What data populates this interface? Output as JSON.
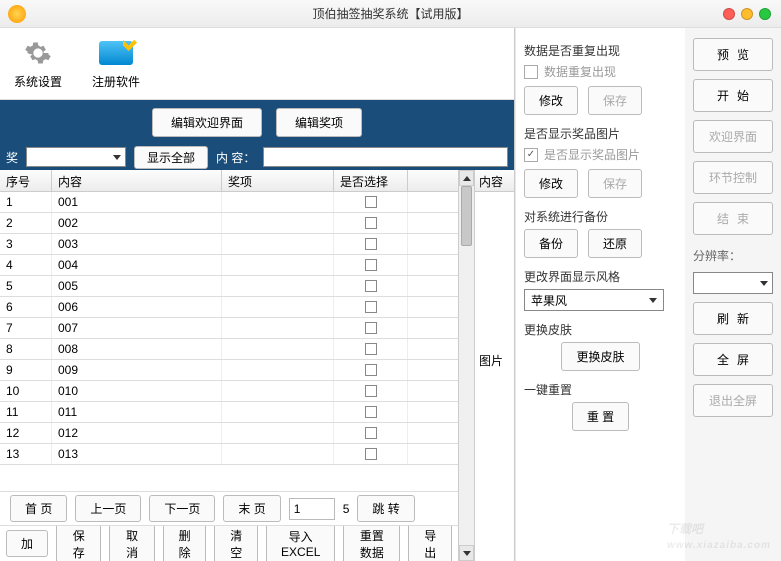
{
  "window": {
    "title": "顶伯抽签抽奖系统【试用版】"
  },
  "toolbar": {
    "settings": "系统设置",
    "register": "注册软件"
  },
  "bluebar": {
    "edit_welcome": "编辑欢迎界面",
    "edit_prize": "编辑奖项"
  },
  "filter": {
    "prize_label": "奖",
    "show_all": "显示全部",
    "content_label": "内    容："
  },
  "table": {
    "headers": {
      "seq": "序号",
      "content": "内容",
      "prize": "奖项",
      "selected": "是否选择"
    },
    "rows": [
      {
        "seq": "1",
        "content": "001"
      },
      {
        "seq": "2",
        "content": "002"
      },
      {
        "seq": "3",
        "content": "003"
      },
      {
        "seq": "4",
        "content": "004"
      },
      {
        "seq": "5",
        "content": "005"
      },
      {
        "seq": "6",
        "content": "006"
      },
      {
        "seq": "7",
        "content": "007"
      },
      {
        "seq": "8",
        "content": "008"
      },
      {
        "seq": "9",
        "content": "009"
      },
      {
        "seq": "10",
        "content": "010"
      },
      {
        "seq": "11",
        "content": "011"
      },
      {
        "seq": "12",
        "content": "012"
      },
      {
        "seq": "13",
        "content": "013"
      }
    ]
  },
  "side": {
    "content": "内容",
    "image": "图片"
  },
  "pager": {
    "first": "首  页",
    "prev": "上一页",
    "next": "下一页",
    "last": "末  页",
    "page": "1",
    "total": "5",
    "jump": "跳    转"
  },
  "actions": {
    "add": "加",
    "save": "保  存",
    "cancel": "取    消",
    "delete": "删除",
    "clear": "清空",
    "export": "导入EXCEL",
    "reset_data": "重置数据",
    "export2": "导出"
  },
  "mid": {
    "sec1_title": "数据是否重复出现",
    "sec1_chk": "数据重复出现",
    "modify": "修改",
    "save": "保存",
    "sec2_title": "是否显示奖品图片",
    "sec2_chk": "是否显示奖品图片",
    "sec3_title": "对系统进行备份",
    "backup": "备份",
    "restore": "还原",
    "sec4_title": "更改界面显示风格",
    "style_value": "苹果风",
    "sec5_title": "更换皮肤",
    "change_skin": "更换皮肤",
    "sec6_title": "一键重置",
    "reset": "重    置"
  },
  "right": {
    "preview": "预览",
    "start": "开始",
    "welcome": "欢迎界面",
    "segment": "环节控制",
    "end": "结束",
    "res_label": "分辨率：",
    "refresh": "刷新",
    "fullscreen": "全屏",
    "exit_fs": "退出全屏"
  },
  "watermark": {
    "main": "下载吧",
    "sub": "www.xiazaiba.com"
  }
}
